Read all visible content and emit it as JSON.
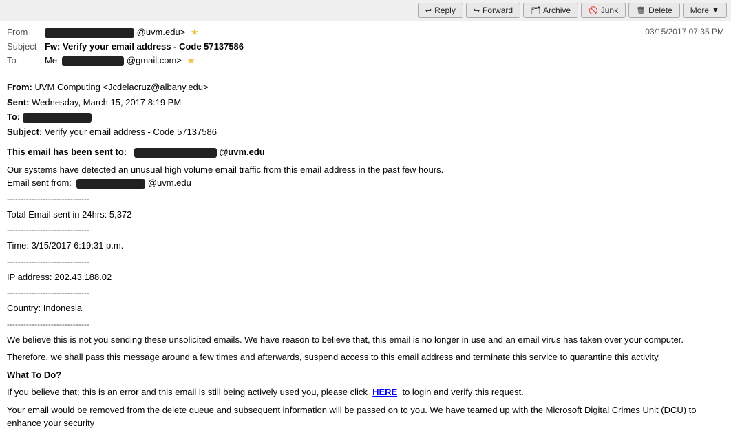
{
  "toolbar": {
    "reply_label": "Reply",
    "forward_label": "Forward",
    "archive_label": "Archive",
    "junk_label": "Junk",
    "delete_label": "Delete",
    "more_label": "More"
  },
  "header": {
    "from_label": "From",
    "from_domain": "@uvm.edu>",
    "subject_label": "Subject",
    "subject_text": "Fw: Verify your email address - Code 57137586",
    "to_label": "To",
    "to_value": "Me",
    "to_domain": "@gmail.com>",
    "date": "03/15/2017 07:35 PM"
  },
  "body": {
    "from_line_label": "From:",
    "from_line_value": "UVM Computing <Jcdelacruz@albany.edu>",
    "sent_label": "Sent:",
    "sent_value": "Wednesday, March 15, 2017 8:19 PM",
    "to_label": "To:",
    "subject_label": "Subject:",
    "subject_value": "Verify your email address - Code 57137586",
    "intro_bold": "This email has been sent to:",
    "intro_domain": "@uvm.edu",
    "paragraph1": "Our systems have detected an unusual high volume email traffic from this email address in the past few hours.",
    "email_sent_from": "Email sent from:",
    "email_domain": "@uvm.edu",
    "divider1": "------------------------------",
    "total_label": "Total Email sent in 24hrs: 5,372",
    "divider2": "------------------------------",
    "time_label": "Time: 3/15/2017 6:19:31 p.m.",
    "divider3": "------------------------------",
    "ip_label": "IP address: 202.43.188.02",
    "divider4": "------------------------------",
    "country_label": "Country: Indonesia",
    "divider5": "------------------------------",
    "belief_para": "We believe this is not you sending these unsolicited emails. We have reason to believe that, this email is no longer in use and an email virus has taken over your computer.",
    "therefore_para": "Therefore, we shall pass this message around a few times and afterwards, suspend access to this email address and terminate this service to quarantine this activity.",
    "what_to_do": "What To Do?",
    "if_you_believe": "If you believe that; this is an error and this email is still being actively used you, please click",
    "here_link": "HERE",
    "after_here": "to login and verify this request.",
    "your_email_para": "Your email would be removed from the delete queue and subsequent information will be passed on to you. We have teamed up with the Microsoft Digital Crimes Unit (DCU) to enhance your security"
  }
}
